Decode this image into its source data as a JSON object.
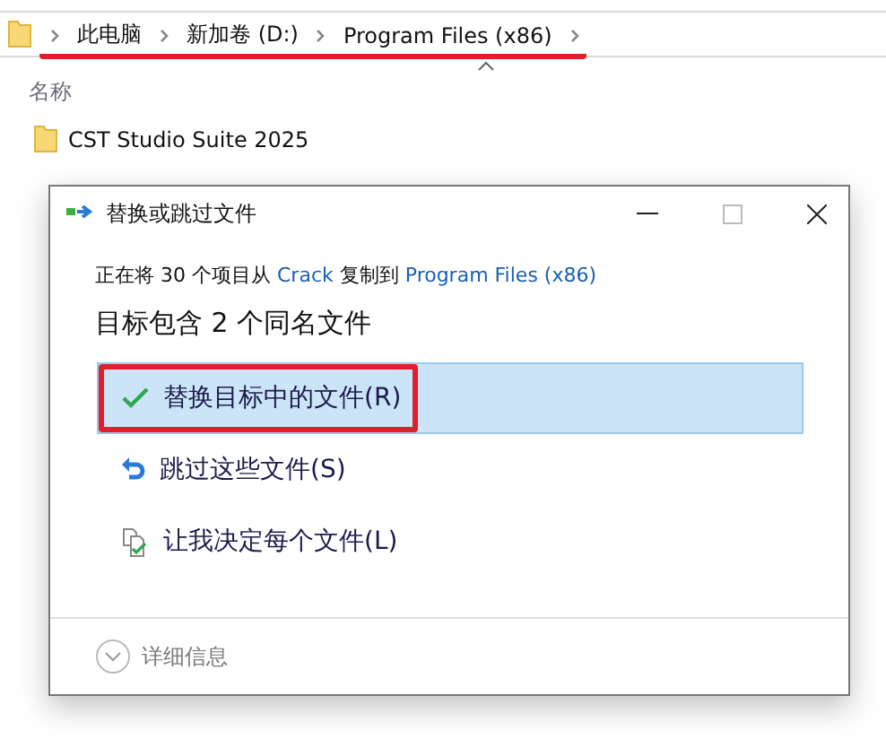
{
  "address_bar": {
    "breadcrumbs": [
      "此电脑",
      "新加卷 (D:)",
      "Program Files (x86)"
    ],
    "underlined": true
  },
  "file_list": {
    "column": "名称",
    "items": [
      {
        "name": "CST Studio Suite 2025"
      }
    ]
  },
  "dialog": {
    "title": "替换或跳过文件",
    "message_parts": [
      {
        "text": "正在将 30 个项目从 ",
        "link": false
      },
      {
        "text": "Crack",
        "link": true
      },
      {
        "text": " 复制到 ",
        "link": false
      },
      {
        "text": "Program Files (x86)",
        "link": true
      }
    ],
    "heading": "目标包含 2 个同名文件",
    "options": [
      {
        "kind": "replace",
        "label": "替换目标中的文件(R)",
        "selected": true,
        "highlighted": true
      },
      {
        "kind": "skip",
        "label": "跳过这些文件(S)",
        "selected": false,
        "highlighted": false
      },
      {
        "kind": "decide",
        "label": "让我决定每个文件(L)",
        "selected": false,
        "highlighted": false
      }
    ],
    "details": "详细信息"
  }
}
